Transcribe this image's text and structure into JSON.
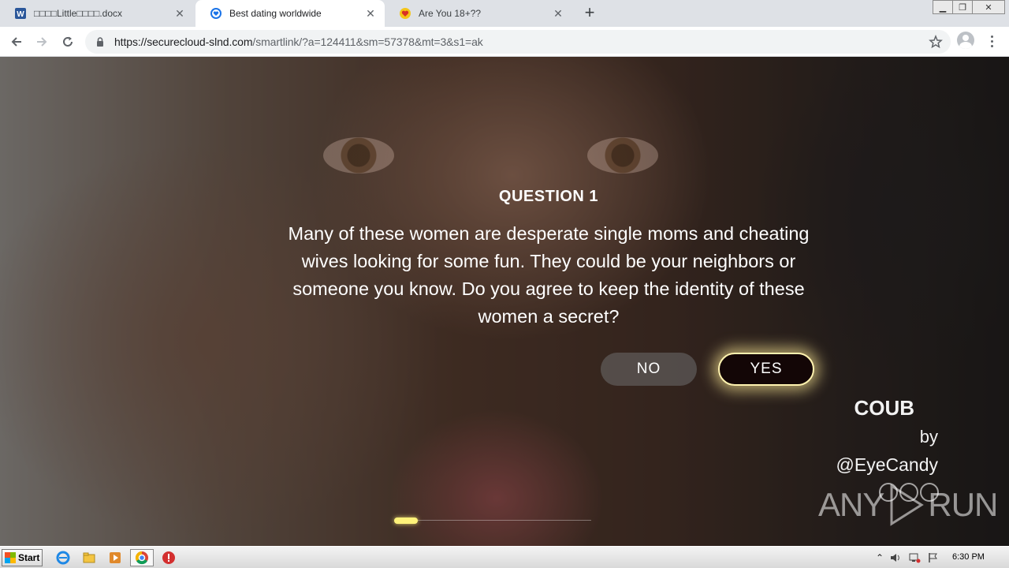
{
  "browser": {
    "tabs": [
      {
        "title": "□□□□Little□□□□.docx",
        "favicon": "word-icon",
        "state": "inactive"
      },
      {
        "title": "Best dating worldwide",
        "favicon": "shield-heart-icon",
        "state": "active"
      },
      {
        "title": "Are You 18+??",
        "favicon": "heart-icon",
        "state": "inactive"
      }
    ],
    "url_host": "https://securecloud-slnd.com",
    "url_path": "/smartlink/?a=124411&sm=57378&mt=3&s1=ak"
  },
  "question": {
    "title": "QUESTION 1",
    "text": "Many of these women are desperate single moms and cheating wives looking for some fun. They could be your neighbors or someone you know. Do you agree to keep the identity of these women a secret?",
    "no_label": "NO",
    "yes_label": "YES"
  },
  "overlay": {
    "logo": "COUB",
    "by": "by",
    "handle": "@EyeCandy"
  },
  "watermark": {
    "left": "ANY",
    "right": "RUN"
  },
  "video": {
    "progress_fraction": 0.12
  },
  "taskbar": {
    "start_label": "Start",
    "clock": "6:30 PM"
  },
  "colors": {
    "yes_glow": "#fff27a",
    "yes_bg": "#130606",
    "tab_strip": "#dee1e6"
  }
}
